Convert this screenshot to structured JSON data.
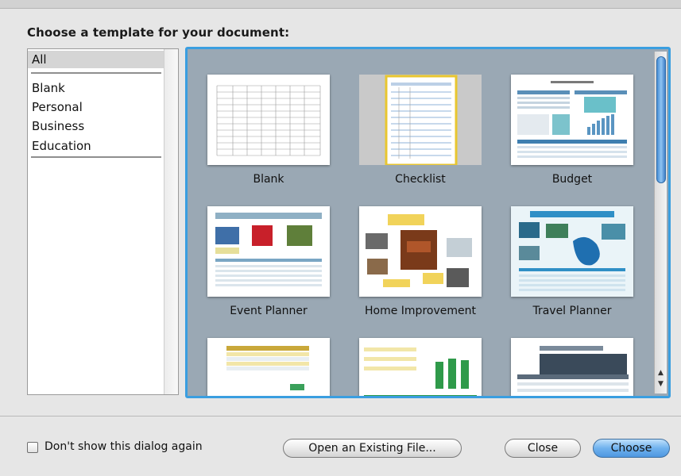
{
  "dialog": {
    "heading": "Choose a template for your document:"
  },
  "sidebar": {
    "all_label": "All",
    "categories": [
      "Blank",
      "Personal",
      "Business",
      "Education"
    ]
  },
  "templates": [
    {
      "label": "Blank",
      "thumb_icon": "blank-grid-thumbnail"
    },
    {
      "label": "Checklist",
      "thumb_icon": "checklist-thumbnail",
      "selected": true
    },
    {
      "label": "Budget",
      "thumb_icon": "budget-thumbnail"
    },
    {
      "label": "Event Planner",
      "thumb_icon": "event-planner-thumbnail"
    },
    {
      "label": "Home Improvement",
      "thumb_icon": "home-improvement-thumbnail"
    },
    {
      "label": "Travel Planner",
      "thumb_icon": "travel-planner-thumbnail"
    },
    {
      "label": "",
      "thumb_icon": "finance-table-thumbnail"
    },
    {
      "label": "",
      "thumb_icon": "green-bar-chart-thumbnail"
    },
    {
      "label": "",
      "thumb_icon": "photo-table-thumbnail"
    }
  ],
  "footer": {
    "dont_show_label": "Don't show this dialog again",
    "open_existing_label": "Open an Existing File...",
    "close_label": "Close",
    "choose_label": "Choose"
  },
  "colors": {
    "selection_border": "#3a9ee0",
    "grid_background": "#9aa8b4",
    "checklist_highlight": "#e8c630",
    "choose_button": "#6fb2ee"
  }
}
